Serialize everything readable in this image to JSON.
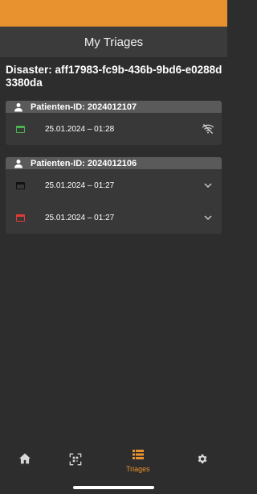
{
  "app_bar": {
    "title": "My Triages"
  },
  "disaster": {
    "label": "Disaster: aff17983-fc9b-436b-9bd6-e0288d3380da"
  },
  "patients": [
    {
      "header": "Patienten-ID: 2024012107",
      "triages": [
        {
          "datetime": "25.01.2024 – 01:28",
          "color": "#4caf50",
          "status_icon": "wifi-off-icon"
        }
      ]
    },
    {
      "header": "Patienten-ID: 2024012106",
      "triages": [
        {
          "datetime": "25.01.2024 – 01:27",
          "color": "#111111",
          "status_icon": "chevron-down-icon"
        },
        {
          "datetime": "25.01.2024 – 01:27",
          "color": "#e53935",
          "status_icon": "chevron-down-icon"
        }
      ]
    }
  ],
  "bottom_nav": {
    "items": [
      {
        "icon": "home-icon",
        "label": ""
      },
      {
        "icon": "qr-scan-icon",
        "label": ""
      },
      {
        "icon": "list-icon",
        "label": "Triages"
      },
      {
        "icon": "gear-icon",
        "label": ""
      }
    ],
    "active_index": 2
  },
  "colors": {
    "accent": "#e8922f",
    "background": "#2d2d2d"
  }
}
